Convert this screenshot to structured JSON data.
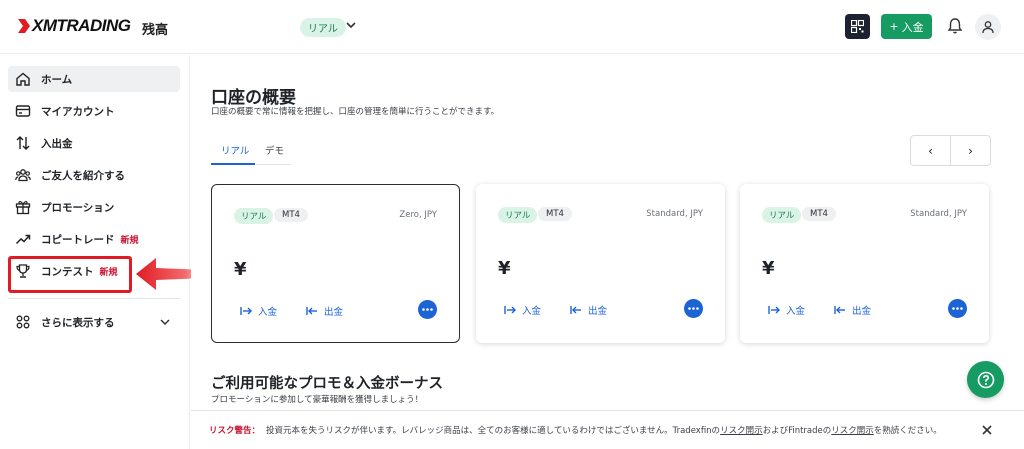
{
  "header": {
    "logo_text": "XMTRADING",
    "balance_label": "残高",
    "account_pill": "リアル",
    "deposit_button": "入金",
    "deposit_plus": "+"
  },
  "sidebar": {
    "items": [
      {
        "label": "ホーム",
        "icon": "home-icon"
      },
      {
        "label": "マイアカウント",
        "icon": "wallet-icon"
      },
      {
        "label": "入出金",
        "icon": "transfer-icon"
      },
      {
        "label": "ご友人を紹介する",
        "icon": "users-icon"
      },
      {
        "label": "プロモーション",
        "icon": "gift-icon"
      },
      {
        "label": "コピートレード",
        "icon": "trend-icon",
        "badge": "新規"
      },
      {
        "label": "コンテスト",
        "icon": "trophy-icon",
        "badge": "新規"
      }
    ],
    "more_label": "さらに表示する"
  },
  "overview": {
    "title": "口座の概要",
    "subtitle": "口座の概要で常に情報を把握し、口座の管理を簡単に行うことができます。",
    "tabs": [
      "リアル",
      "デモ"
    ],
    "pager_prev": "‹",
    "pager_next": "›"
  },
  "accounts": [
    {
      "type_pill": "リアル",
      "platform": "MT4",
      "account_type": "Zero, JPY",
      "balance": "¥",
      "deposit": "入金",
      "withdraw": "出金"
    },
    {
      "type_pill": "リアル",
      "platform": "MT4",
      "account_type": "Standard, JPY",
      "balance": "¥",
      "deposit": "入金",
      "withdraw": "出金"
    },
    {
      "type_pill": "リアル",
      "platform": "MT4",
      "account_type": "Standard, JPY",
      "balance": "¥",
      "deposit": "入金",
      "withdraw": "出金"
    }
  ],
  "promos": {
    "title": "ご利用可能なプロモ＆入金ボーナス",
    "subtitle": "プロモーションに参加して豪華報酬を獲得しましょう！"
  },
  "risk": {
    "label": "リスク警告：",
    "text1": "投資元本を失うリスクが伴います。レバレッジ商品は、全てのお客様に適しているわけではございません。Tradexfinの",
    "link1": "リスク開示",
    "text2": "およびFintradeの",
    "link2": "リスク開示",
    "text3": "を熟読ください。"
  },
  "colors": {
    "brand_green": "#169b62",
    "link_blue": "#1c63d4",
    "alert_red": "#c8102e",
    "highlight_red": "#e01b24"
  }
}
